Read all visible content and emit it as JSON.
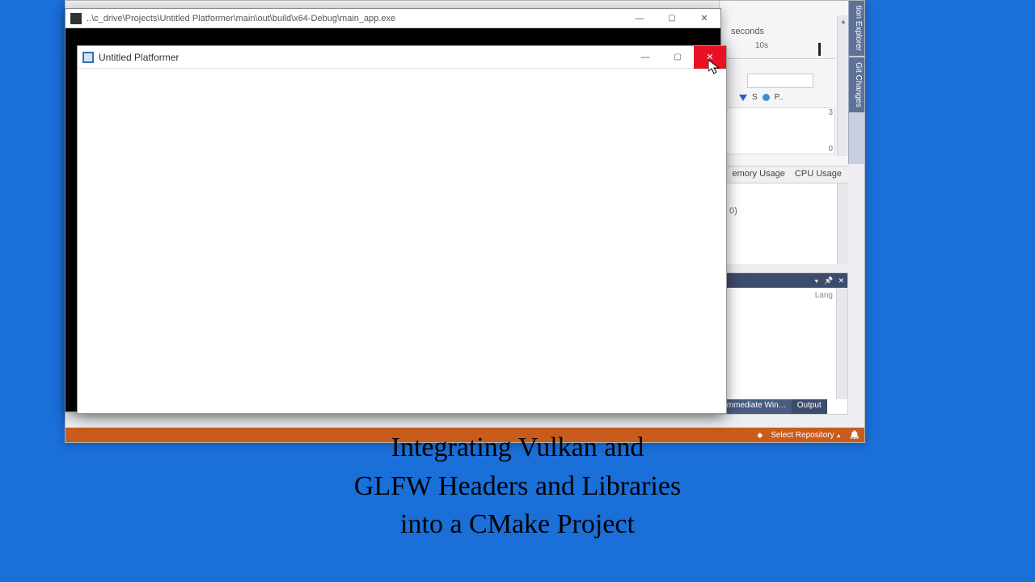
{
  "vs": {
    "rightTabs": {
      "sol": "tion Explorer",
      "git": "Git Changes"
    },
    "diag": {
      "seconds": "seconds",
      "tick10": "10s",
      "legendS": "S",
      "legendP": "P..",
      "y3": "3",
      "y0": "0",
      "memTab": "emory Usage",
      "cpuTab": "CPU Usage",
      "countN": "0)"
    },
    "output": {
      "lang": "Lang",
      "tabImmediate": "Immediate Win…",
      "tabOutput": "Output"
    },
    "status": {
      "repo": "Select Repository"
    }
  },
  "console": {
    "path": "..\\c_drive\\Projects\\Untitled Platformer\\main\\out\\build\\x64-Debug\\main_app.exe"
  },
  "app": {
    "title": "Untitled Platformer"
  },
  "caption": {
    "line1": "Integrating Vulkan and",
    "line2": "GLFW Headers and Libraries",
    "line3": "into a CMake Project"
  }
}
